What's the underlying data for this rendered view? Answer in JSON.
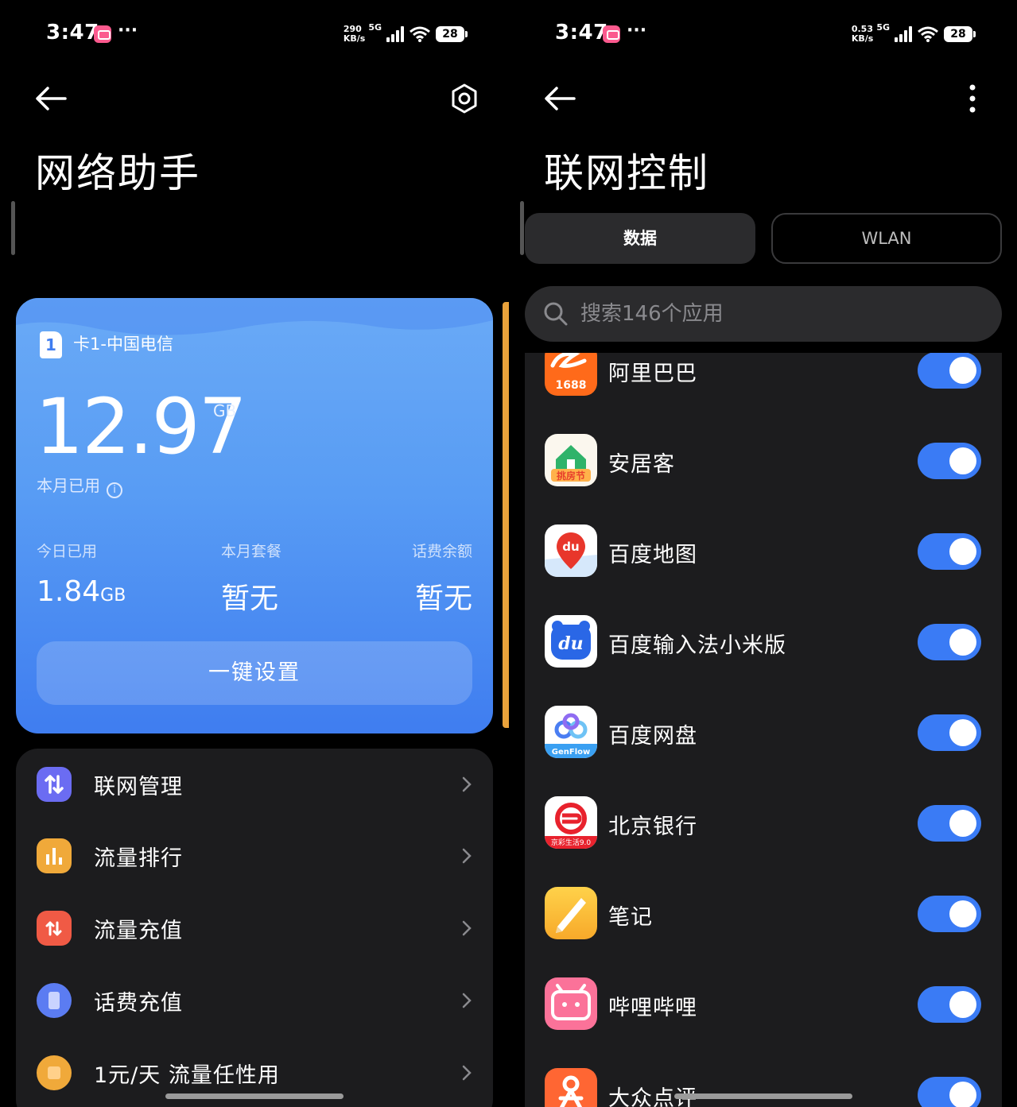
{
  "left_screen": {
    "status": {
      "time": "3:47",
      "dots": "···",
      "speed_value": "290",
      "speed_unit": "KB/s",
      "network": "5G",
      "battery": "28"
    },
    "title": "网络助手",
    "card": {
      "sim_index": "1",
      "sim_name": "卡1-中国电信",
      "monthly_used": "12.97",
      "monthly_unit": "GB",
      "monthly_label": "本月已用",
      "today_label": "今日已用",
      "today_value": "1.84",
      "today_unit": "GB",
      "plan_label": "本月套餐",
      "plan_value": "暂无",
      "balance_label": "话费余额",
      "balance_value": "暂无",
      "onekey_button": "一键设置"
    },
    "menu": [
      {
        "label": "联网管理",
        "icon": "network-arrows-icon",
        "color": "#6b6cf2"
      },
      {
        "label": "流量排行",
        "icon": "bar-chart-icon",
        "color": "#f0a93a"
      },
      {
        "label": "流量充值",
        "icon": "data-recharge-icon",
        "color": "#f05a45"
      },
      {
        "label": "话费充值",
        "icon": "phone-recharge-icon",
        "color": "#5b7cf2"
      },
      {
        "label": "1元/天 流量任性用",
        "icon": "daily-pass-icon",
        "color": "#f0a93a"
      }
    ]
  },
  "right_screen": {
    "status": {
      "time": "3:47",
      "dots": "···",
      "speed_value": "0.53",
      "speed_unit": "KB/s",
      "network": "5G",
      "battery": "28"
    },
    "title": "联网控制",
    "tabs": {
      "data": "数据",
      "wlan": "WLAN"
    },
    "search": {
      "placeholder": "搜索146个应用"
    },
    "apps": [
      {
        "name": "阿里巴巴",
        "icon": "alibaba-1688-icon",
        "enabled": true
      },
      {
        "name": "安居客",
        "icon": "anjuke-icon",
        "enabled": true
      },
      {
        "name": "百度地图",
        "icon": "baidu-map-icon",
        "enabled": true
      },
      {
        "name": "百度输入法小米版",
        "icon": "baidu-input-icon",
        "enabled": true
      },
      {
        "name": "百度网盘",
        "icon": "baidu-netdisk-icon",
        "enabled": true
      },
      {
        "name": "北京银行",
        "icon": "bank-of-beijing-icon",
        "enabled": true
      },
      {
        "name": "笔记",
        "icon": "notes-icon",
        "enabled": true
      },
      {
        "name": "哔哩哔哩",
        "icon": "bilibili-icon",
        "enabled": true
      },
      {
        "name": "大众点评",
        "icon": "dianping-icon",
        "enabled": true
      }
    ],
    "app_icon_text": {
      "alibaba": "1688",
      "anjuke": "挑房节",
      "baidu_map": "du",
      "baidu_input": "du",
      "netdisk": "GenFlow",
      "bank": "京彩生活9.0"
    },
    "colors": {
      "accent": "#3a7bf5",
      "card_blue": "#589cf4",
      "surface": "#1c1c1e"
    }
  }
}
